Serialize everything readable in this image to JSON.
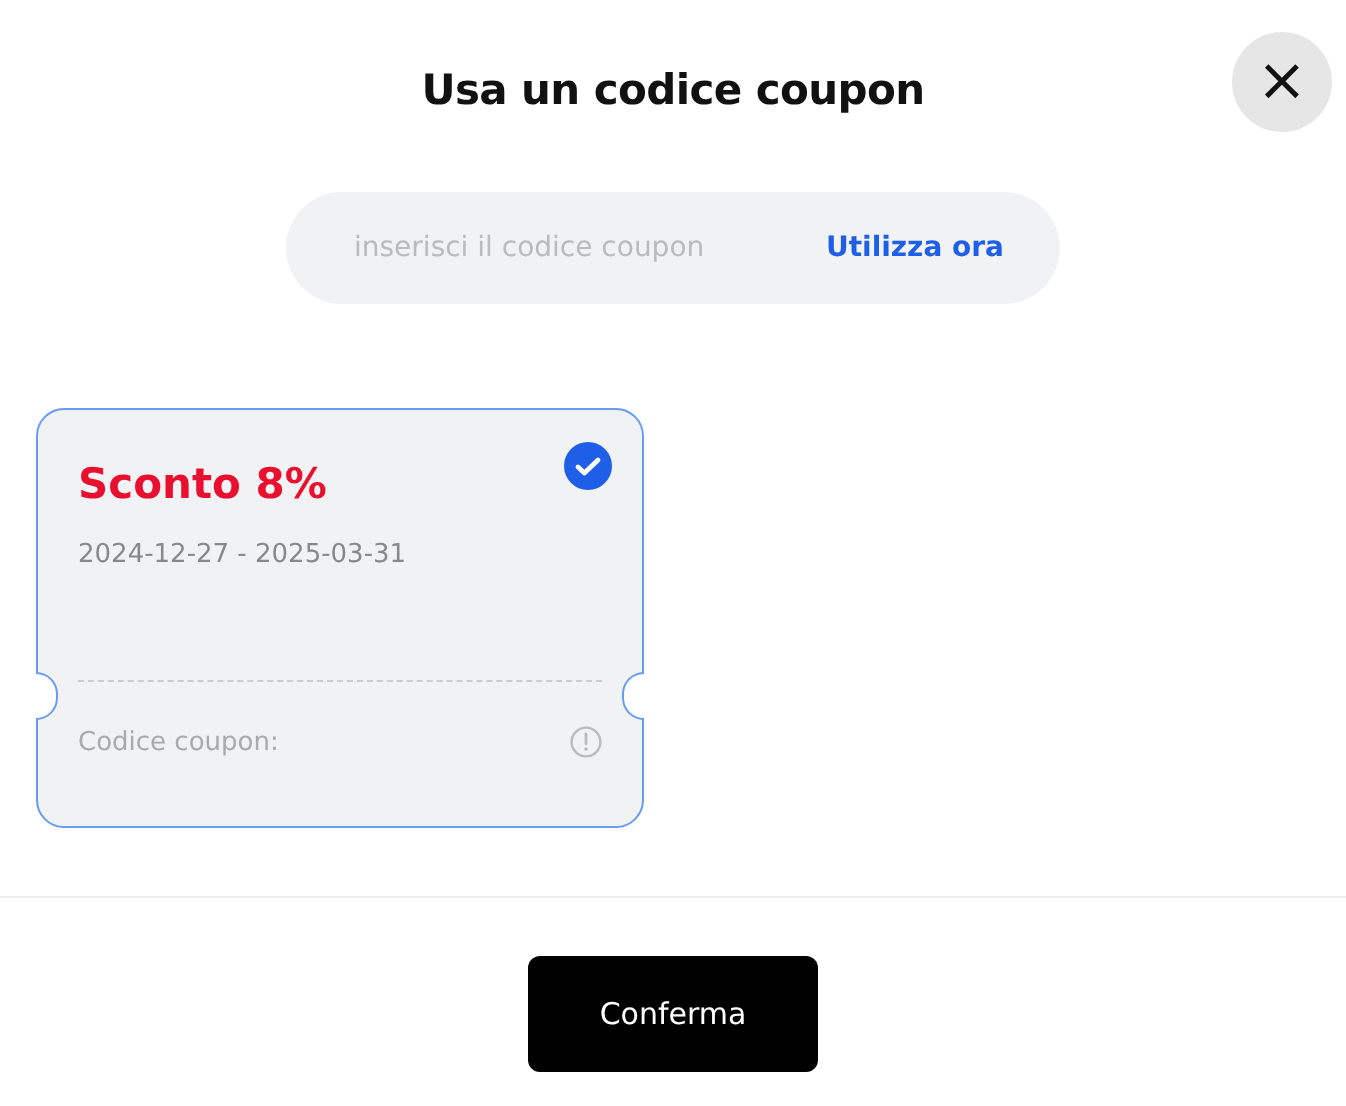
{
  "title": "Usa un codice coupon",
  "close_button": {
    "label": "×"
  },
  "coupon_field": {
    "placeholder": "inserisci il codice coupon",
    "action": "Utilizza ora"
  },
  "coupons": [
    {
      "name": "Sconto 8%",
      "validity": "2024-12-27 - 2025-03-31",
      "code_label": "Codice coupon:",
      "selected": true
    }
  ],
  "confirm_button": "Conferma"
}
